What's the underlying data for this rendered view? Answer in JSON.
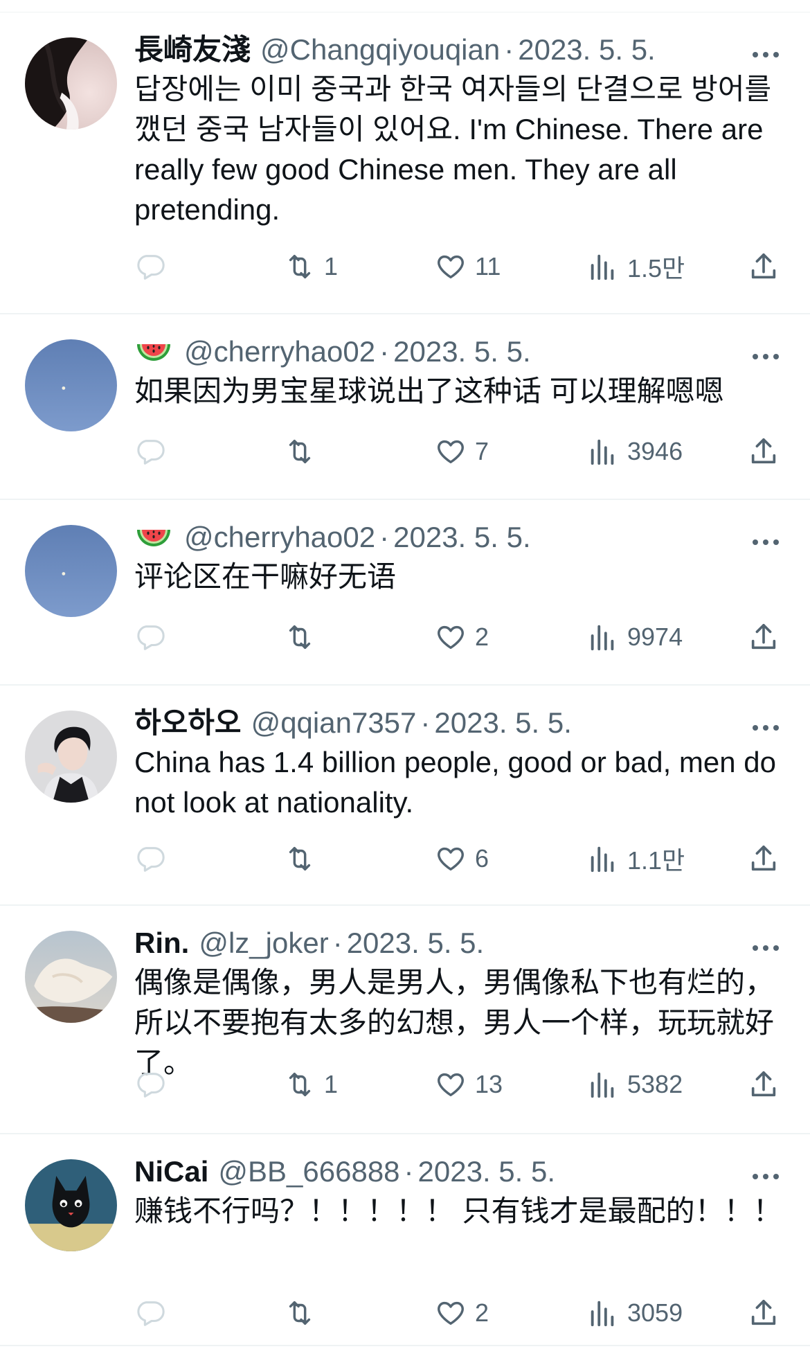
{
  "colors": {
    "text_primary": "#0f1419",
    "text_secondary": "#536471",
    "divider": "#eff3f4",
    "reply_icon": "#cfd9de"
  },
  "tweets": [
    {
      "display_name": "長崎友淺",
      "handle": "@Changqiyouqian",
      "separator": "·",
      "date": "2023. 5. 5.",
      "text": "답장에는 이미 중국과 한국 여자들의 단결으로 방어를 깼던 중국 남자들이 있어요. I'm Chinese. There are really few good Chinese men. They are all pretending.",
      "retweets": "1",
      "likes": "11",
      "views": "1.5만",
      "avatar": "dark-hair-photo"
    },
    {
      "display_name": "",
      "name_emoji": "watermelon-icon",
      "handle": "@cherryhao02",
      "separator": "·",
      "date": "2023. 5. 5.",
      "text": "如果因为男宝星球说出了这种话 可以理解嗯嗯",
      "retweets": "",
      "likes": "7",
      "views": "3946",
      "avatar": "sky-moon-photo"
    },
    {
      "display_name": "",
      "name_emoji": "watermelon-icon",
      "handle": "@cherryhao02",
      "separator": "·",
      "date": "2023. 5. 5.",
      "text": "评论区在干嘛好无语",
      "retweets": "",
      "likes": "2",
      "views": "9974",
      "avatar": "sky-moon-photo"
    },
    {
      "display_name": "하오하오",
      "handle": "@qqian7357",
      "separator": "·",
      "date": "2023. 5. 5.",
      "text": "China has 1.4 billion people, good or bad, men do not look at nationality.",
      "retweets": "",
      "likes": "6",
      "views": "1.1만",
      "avatar": "young-man-photo"
    },
    {
      "display_name": "Rin.",
      "handle": "@lz_joker",
      "separator": "·",
      "date": "2023. 5. 5.",
      "text": "偶像是偶像，男人是男人，男偶像私下也有烂的，所以不要抱有太多的幻想，男人一个样，玩玩就好了。",
      "retweets": "1",
      "likes": "13",
      "views": "5382",
      "avatar": "white-fabric-photo"
    },
    {
      "display_name": "NiCai",
      "handle": "@BB_666888",
      "separator": "·",
      "date": "2023. 5. 5.",
      "text": "赚钱不行吗？！！！！！ 只有钱才是最配的！！！",
      "retweets": "",
      "likes": "2",
      "views": "3059",
      "avatar": "black-cat-photo"
    }
  ]
}
